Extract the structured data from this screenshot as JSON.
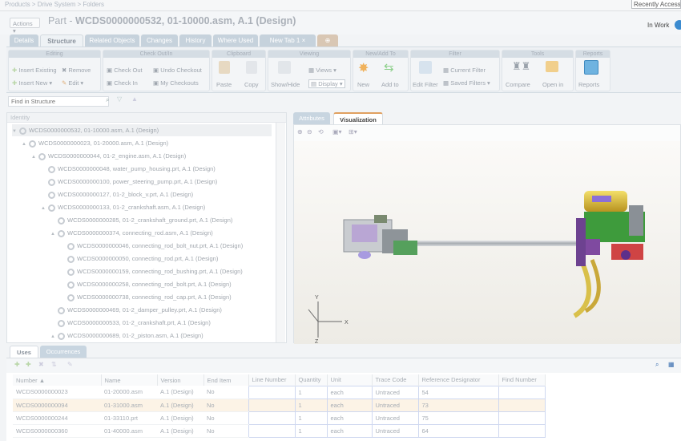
{
  "topbar": {
    "breadcrumb": "Products > Drive System > Folders",
    "recently_accessed": "Recently Accessed"
  },
  "header": {
    "actions_label": "Actions ▾",
    "title_prefix": "Part - ",
    "title": "WCDS0000000532, 01-10000.asm, A.1 (Design)",
    "status": "In Work"
  },
  "tabs": [
    "Details",
    "Structure",
    "Related Objects",
    "Changes",
    "History",
    "Where Used",
    "New Tab 1"
  ],
  "ribbon": {
    "groups": [
      "Editing",
      "Check Out/In",
      "Clipboard",
      "Viewing",
      "New/Add To",
      "Filter",
      "Tools",
      "Reports"
    ],
    "insert_existing": "Insert Existing",
    "remove": "Remove",
    "insert_new": "Insert New ▾",
    "edit": "Edit ▾",
    "check_out": "Check Out",
    "undo_checkout": "Undo Checkout",
    "check_in": "Check In",
    "my_checkouts": "My Checkouts",
    "paste": "Paste",
    "copy": "Copy",
    "show_hide": "Show/Hide",
    "views": "Views ▾",
    "display": "Display",
    "new": "New",
    "add_to": "Add to",
    "edit_filter": "Edit Filter",
    "current_filter": "Current Filter",
    "saved_filters": "Saved Filters ▾",
    "compare": "Compare",
    "open_in": "Open in",
    "reports": "Reports"
  },
  "find": {
    "placeholder": "Find in Structure"
  },
  "tree": {
    "header": "Identity",
    "rows": [
      {
        "label": "WCDS0000000532, 01-10000.asm, A.1 (Design)",
        "expander": "▼"
      },
      {
        "label": "WCDS0000000023, 01-20000.asm, A.1 (Design)",
        "expander": "▲"
      },
      {
        "label": "WCDS0000000044, 01-2_engine.asm, A.1 (Design)",
        "expander": "▲"
      },
      {
        "label": "WCDS0000000048, water_pump_housing.prt, A.1 (Design)",
        "expander": ""
      },
      {
        "label": "WCDS0000000100, power_steering_pump.prt, A.1 (Design)",
        "expander": ""
      },
      {
        "label": "WCDS0000000127, 01-2_block_v.prt, A.1 (Design)",
        "expander": ""
      },
      {
        "label": "WCDS0000000133, 01-2_crankshaft.asm, A.1 (Design)",
        "expander": "▲"
      },
      {
        "label": "WCDS0000000285, 01-2_crankshaft_ground.prt, A.1 (Design)",
        "expander": ""
      },
      {
        "label": "WCDS0000000374, connecting_rod.asm, A.1 (Design)",
        "expander": "▲"
      },
      {
        "label": "WCDS0000000046, connecting_rod_bolt_nut.prt, A.1 (Design)",
        "expander": ""
      },
      {
        "label": "WCDS0000000050, connecting_rod.prt, A.1 (Design)",
        "expander": ""
      },
      {
        "label": "WCDS0000000159, connecting_rod_bushing.prt, A.1 (Design)",
        "expander": ""
      },
      {
        "label": "WCDS0000000258, connecting_rod_bolt.prt, A.1 (Design)",
        "expander": ""
      },
      {
        "label": "WCDS0000000738, connecting_rod_cap.prt, A.1 (Design)",
        "expander": ""
      },
      {
        "label": "WCDS0000000469, 01-2_damper_pulley.prt, A.1 (Design)",
        "expander": ""
      },
      {
        "label": "WCDS0000000533, 01-2_crankshaft.prt, A.1 (Design)",
        "expander": ""
      },
      {
        "label": "WCDS0000000689, 01-2_piston.asm, A.1 (Design)",
        "expander": "▲"
      }
    ]
  },
  "right_tabs": [
    "Attributes",
    "Visualization"
  ],
  "viz": {
    "axis_x": "X",
    "axis_y": "Y",
    "axis_z": "Z"
  },
  "bottom_tabs": [
    "Uses",
    "Occurrences"
  ],
  "uses_table": {
    "columns": [
      "Number ▲",
      "Name",
      "Version",
      "End Item",
      "Line Number",
      "Quantity",
      "Unit",
      "Trace Code",
      "Reference Designator",
      "Find Number"
    ],
    "rows": [
      [
        "WCDS0000000023",
        "01-20000.asm",
        "A.1 (Design)",
        "No",
        "",
        "1",
        "each",
        "Untraced",
        "54",
        ""
      ],
      [
        "WCDS0000000094",
        "01-31000.asm",
        "A.1 (Design)",
        "No",
        "",
        "1",
        "each",
        "Untraced",
        "73",
        ""
      ],
      [
        "WCDS0000000244",
        "01-33110.prt",
        "A.1 (Design)",
        "No",
        "",
        "1",
        "each",
        "Untraced",
        "75",
        ""
      ],
      [
        "WCDS0000000360",
        "01-40000.asm",
        "A.1 (Design)",
        "No",
        "",
        "1",
        "each",
        "Untraced",
        "64",
        ""
      ]
    ]
  }
}
